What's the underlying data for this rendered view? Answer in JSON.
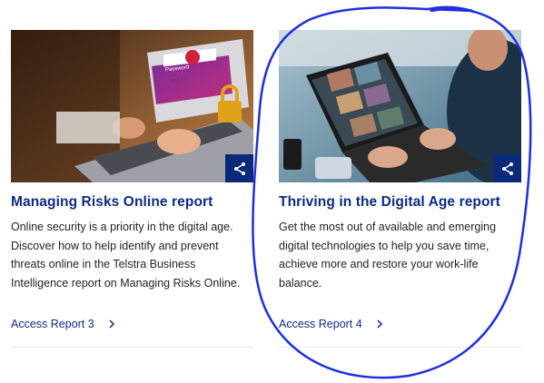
{
  "cards": [
    {
      "title": "Managing Risks Online report",
      "description": "Online security is a priority in the digital age. Discover how to help identify and prevent threats online in the Telstra Business Intelligence report on Managing Risks Online.",
      "image_caption": "Password",
      "password_mask": "*****",
      "link_label": "Access Report 3",
      "share_icon": "share-icon"
    },
    {
      "title": "Thriving in the Digital Age report",
      "description": "Get the most out of available and emerging digital technologies to help you save time, achieve more and restore your work-life balance.",
      "link_label": "Access Report 4",
      "share_icon": "share-icon"
    }
  ],
  "colors": {
    "brand_navy": "#0d2b86",
    "share_bg": "#0a2a78",
    "annotation_circle": "#1f2fe0"
  }
}
